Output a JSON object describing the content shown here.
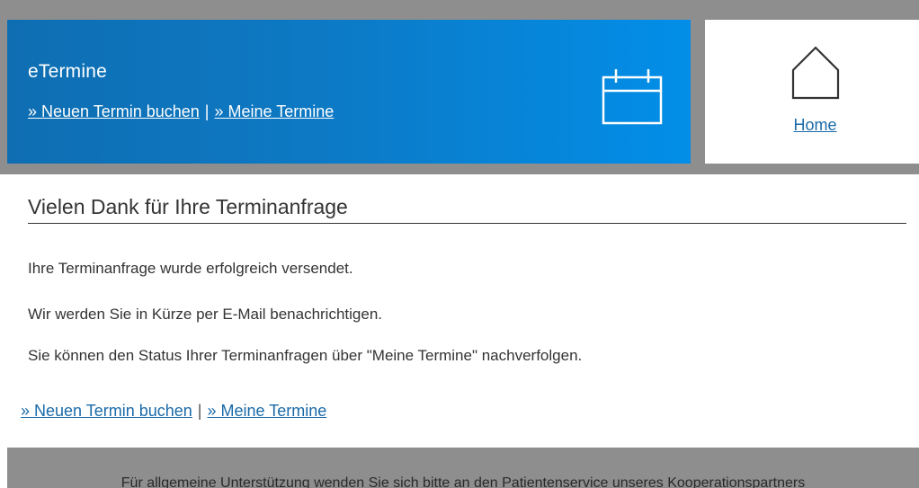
{
  "colors": {
    "banner_gradient_start": "#0f6eb2",
    "banner_gradient_end": "#028ee8",
    "header_band": "#8e8e8e",
    "link": "#1a6aa8",
    "text": "#333333"
  },
  "banner": {
    "title": "eTermine",
    "link_new": "» Neuen Termin buchen",
    "separator": "|",
    "link_my": "» Meine Termine",
    "icon": "calendar-icon"
  },
  "home": {
    "icon": "home-icon",
    "label": "Home"
  },
  "main": {
    "title": "Vielen Dank für Ihre Terminanfrage",
    "messages": [
      "Ihre Terminanfrage wurde erfolgreich versendet.",
      "Wir werden Sie in Kürze per E-Mail benachrichtigen.",
      "Sie können den Status Ihrer Terminanfragen über \"Meine Termine\" nachverfolgen."
    ],
    "link_new": "» Neuen Termin buchen",
    "separator": "|",
    "link_my": "» Meine Termine"
  },
  "footer": {
    "text": "Für allgemeine Unterstützung wenden Sie sich bitte an den Patientenservice unseres Kooperationspartners"
  }
}
